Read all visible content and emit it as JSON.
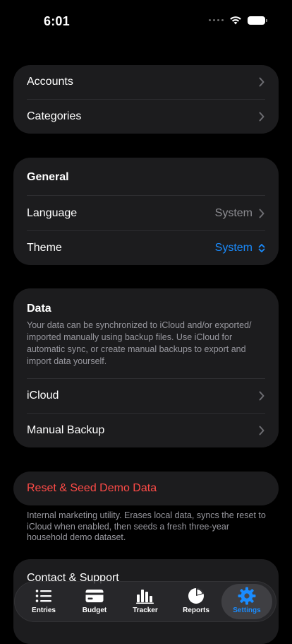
{
  "status": {
    "time": "6:01"
  },
  "accounts_group": {
    "accounts_label": "Accounts",
    "categories_label": "Categories"
  },
  "general": {
    "title": "General",
    "language_label": "Language",
    "language_value": "System",
    "theme_label": "Theme",
    "theme_value": "System"
  },
  "data": {
    "title": "Data",
    "description": "Your data can be synchronized to iCloud and/or exported/ imported manually using backup files. Use iCloud for automatic sync, or create manual backups to export and import data yourself.",
    "icloud_label": "iCloud",
    "manual_backup_label": "Manual Backup"
  },
  "reset": {
    "label": "Reset & Seed Demo Data",
    "note": "Internal marketing utility. Erases local data, syncs the reset to iCloud when enabled, then seeds a fresh three-year household demo dataset."
  },
  "contact": {
    "title": "Contact & Support"
  },
  "tabs": [
    {
      "label": "Entries",
      "icon": "list-icon"
    },
    {
      "label": "Budget",
      "icon": "credit-card-icon"
    },
    {
      "label": "Tracker",
      "icon": "bar-chart-icon"
    },
    {
      "label": "Reports",
      "icon": "pie-chart-icon"
    },
    {
      "label": "Settings",
      "icon": "gear-icon"
    }
  ],
  "colors": {
    "accent": "#1a8cff",
    "destructive": "#ff4b47",
    "card": "#1c1c1e",
    "background": "#000000"
  }
}
